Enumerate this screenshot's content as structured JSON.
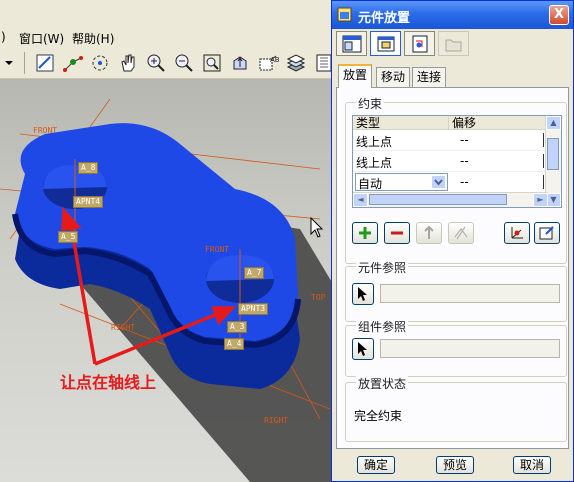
{
  "app": {
    "menu": [
      {
        "label": ")",
        "name": "menu-prev-tail"
      },
      {
        "label": "窗口(W)",
        "name": "menu-window"
      },
      {
        "label": "帮助(H)",
        "name": "menu-help"
      }
    ],
    "toolbar_icons": [
      "dropdown-arrow-icon",
      "sketch-icon",
      "datum-point-icon",
      "spin-icon",
      "pan-icon",
      "zoom-in-icon",
      "zoom-out-icon",
      "refit-icon",
      "orient-icon",
      "named-view-icon",
      "layers-icon",
      "model-tree-icon"
    ]
  },
  "viewport": {
    "datum_labels": {
      "front_top": "FRONT",
      "front_mid": "FRONT",
      "right_left": "RIGHT",
      "right_bottom": "RIGHT",
      "top_right": "TOP"
    },
    "tags": {
      "a8": "A_8",
      "apnt4": "APNT4",
      "a5": "A_5",
      "a7": "A_7",
      "apnt3": "APNT3",
      "a3": "A_3",
      "a4": "A_4"
    },
    "annotation": "让点在轴线上",
    "colors": {
      "part": "#1a3fd6",
      "shadow": "#3a3a3a",
      "datum": "#d4591a",
      "arrow": "#e51b1b"
    }
  },
  "dialog": {
    "title": "元件放置",
    "close_label": "X",
    "tabs": {
      "placement": "放置",
      "move": "移动",
      "connect": "连接"
    },
    "constraints": {
      "group_label": "约束",
      "headers": {
        "type": "类型",
        "offset": "偏移"
      },
      "rows": [
        {
          "type": "线上点",
          "offset": "--"
        },
        {
          "type": "线上点",
          "offset": "--"
        },
        {
          "type": "自动",
          "offset": "--"
        }
      ]
    },
    "component_ref_label": "元件参照",
    "assembly_ref_label": "组件参照",
    "status_label": "放置状态",
    "status_value": "完全约束",
    "buttons": {
      "ok": "确定",
      "preview": "预览",
      "cancel": "取消"
    }
  }
}
